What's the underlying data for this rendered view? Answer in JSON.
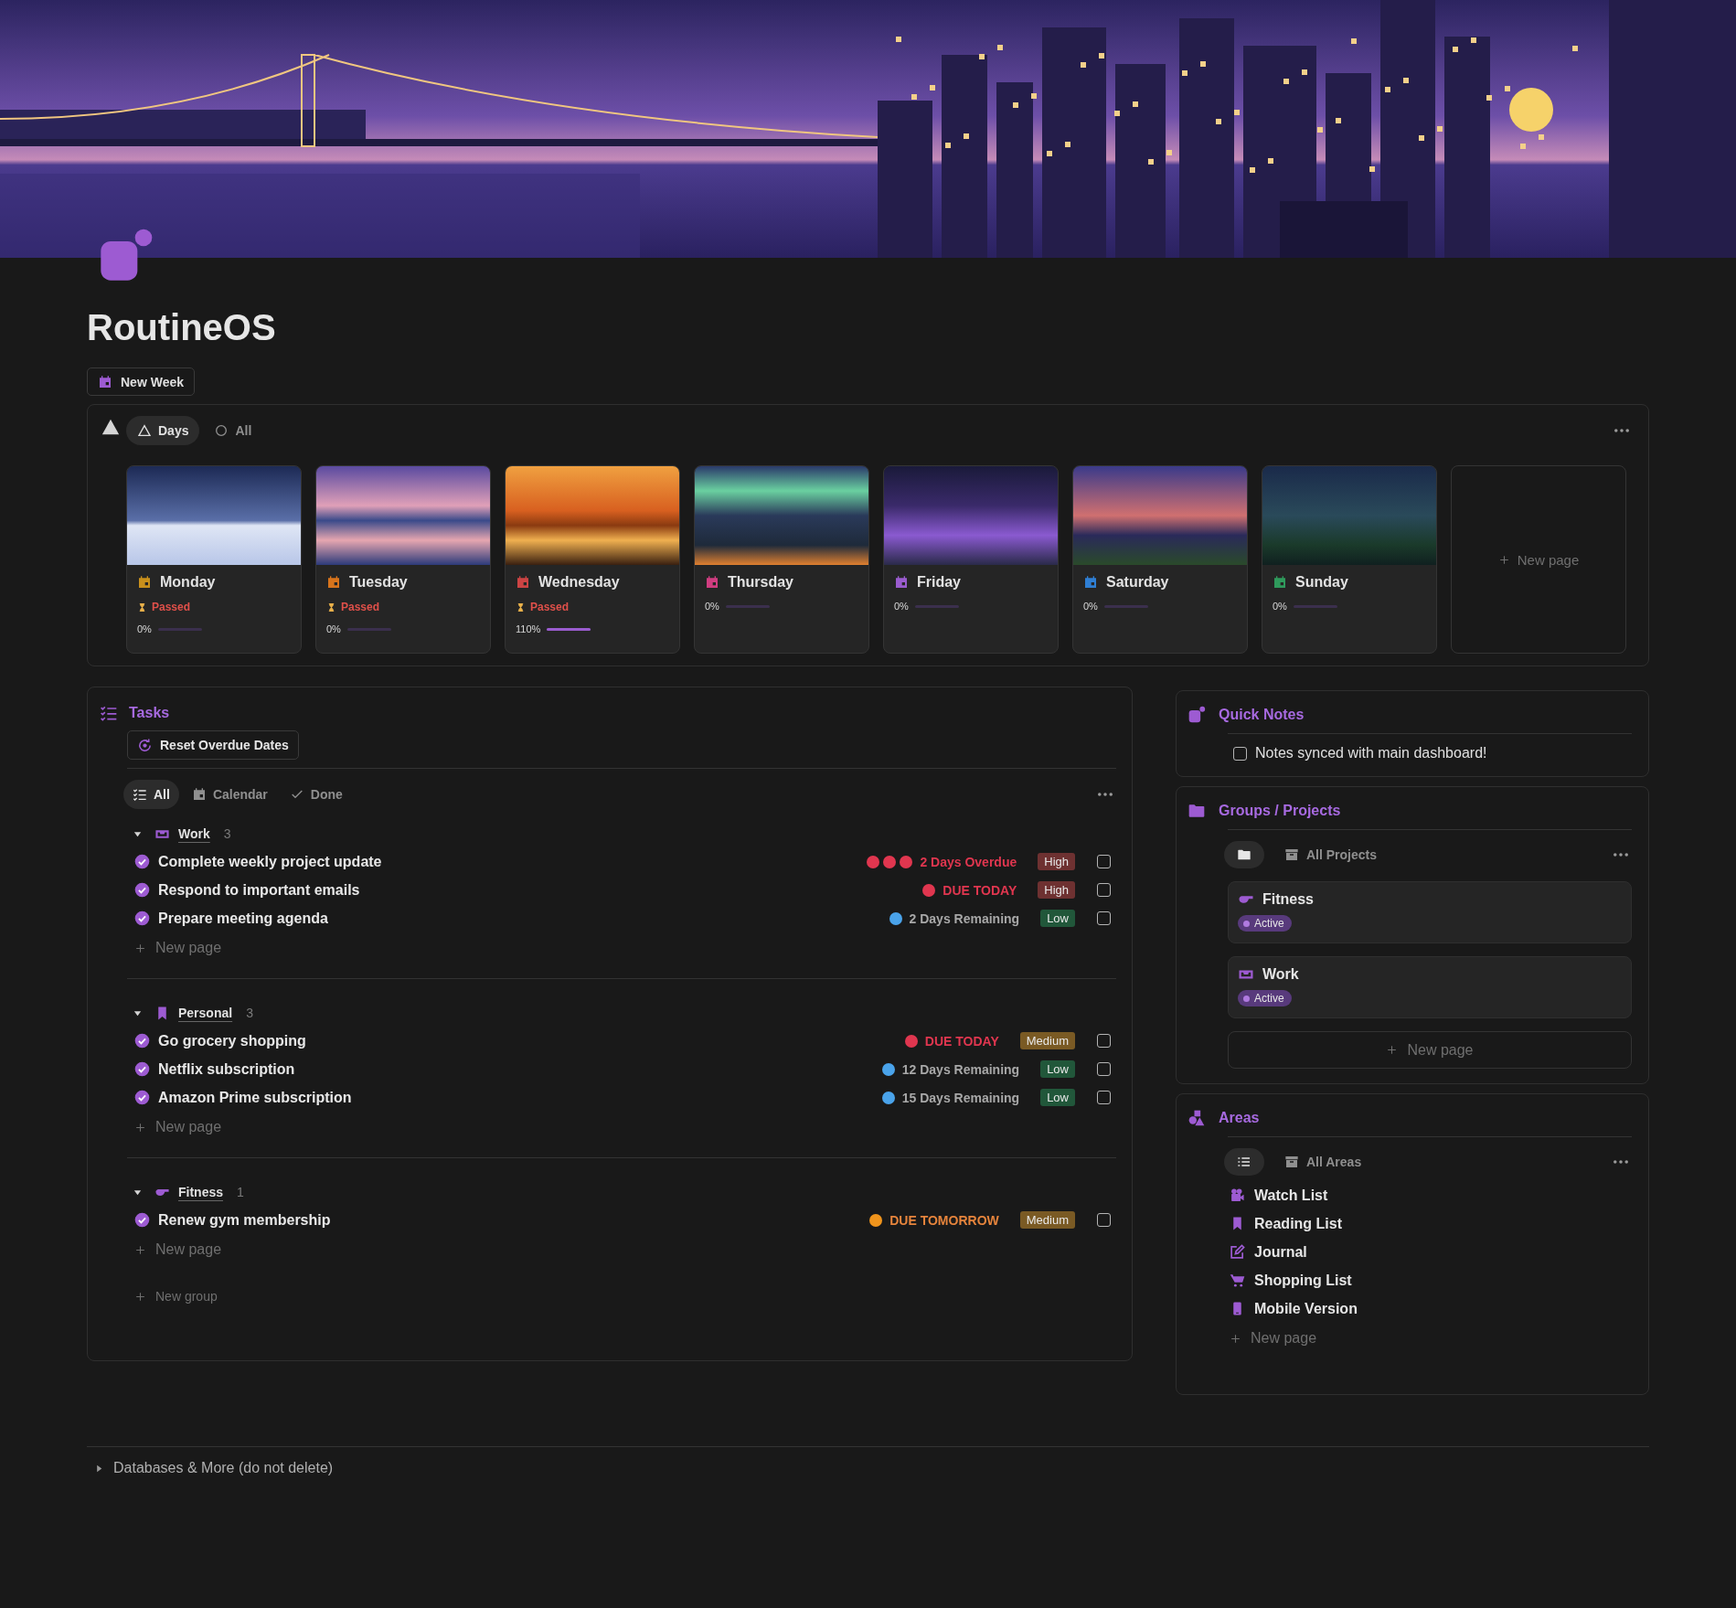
{
  "page": {
    "title": "RoutineOS"
  },
  "new_week_button": "New Week",
  "days": {
    "tabs": [
      {
        "label": "Days",
        "selected": true
      },
      {
        "label": "All",
        "selected": false
      }
    ],
    "cards": [
      {
        "name": "Monday",
        "color": "#c9901c",
        "status": "Passed",
        "progress": "0%",
        "level": 0
      },
      {
        "name": "Tuesday",
        "color": "#d8741c",
        "status": "Passed",
        "progress": "0%",
        "level": 0
      },
      {
        "name": "Wednesday",
        "color": "#cc4444",
        "status": "Passed",
        "progress": "110%",
        "level": 1
      },
      {
        "name": "Thursday",
        "color": "#d03d80",
        "progress": "0%",
        "level": 0
      },
      {
        "name": "Friday",
        "color": "#9a5ccf",
        "progress": "0%",
        "level": 0
      },
      {
        "name": "Saturday",
        "color": "#2f7fd4",
        "progress": "0%",
        "level": 0
      },
      {
        "name": "Sunday",
        "color": "#2f9a5c",
        "progress": "0%",
        "level": 0
      }
    ],
    "new_page": "New page"
  },
  "tasks": {
    "title": "Tasks",
    "reset_button": "Reset Overdue Dates",
    "views": [
      {
        "label": "All",
        "selected": true
      },
      {
        "label": "Calendar",
        "selected": false
      },
      {
        "label": "Done",
        "selected": false
      }
    ],
    "groups": [
      {
        "name": "Work",
        "count": "3",
        "expanded": true,
        "items": [
          {
            "title": "Complete weekly project update",
            "due": {
              "kind": "overdue",
              "text": "2 Days Overdue",
              "color": "#e0364f"
            },
            "priority": {
              "label": "High",
              "color": "#6e3131"
            },
            "checked": false
          },
          {
            "title": "Respond to important emails",
            "due": {
              "kind": "today",
              "text": "DUE TODAY",
              "color": "#e0364f"
            },
            "priority": {
              "label": "High",
              "color": "#6e3131"
            },
            "checked": false
          },
          {
            "title": "Prepare meeting agenda",
            "due": {
              "kind": "remaining",
              "text": "2 Days Remaining",
              "color": "#4aa3ea"
            },
            "priority": {
              "label": "Low",
              "color": "#21573a"
            },
            "checked": false
          }
        ],
        "new_page": "New page"
      },
      {
        "name": "Personal",
        "count": "3",
        "expanded": true,
        "items": [
          {
            "title": "Go grocery shopping",
            "due": {
              "kind": "today",
              "text": "DUE TODAY",
              "color": "#e0364f"
            },
            "priority": {
              "label": "Medium",
              "color": "#7a5a24"
            },
            "checked": false
          },
          {
            "title": "Netflix subscription",
            "due": {
              "kind": "remaining",
              "text": "12 Days Remaining",
              "color": "#4aa3ea"
            },
            "priority": {
              "label": "Low",
              "color": "#21573a"
            },
            "checked": false
          },
          {
            "title": "Amazon Prime subscription",
            "due": {
              "kind": "remaining",
              "text": "15 Days Remaining",
              "color": "#4aa3ea"
            },
            "priority": {
              "label": "Low",
              "color": "#21573a"
            },
            "checked": false
          }
        ],
        "new_page": "New page"
      },
      {
        "name": "Fitness",
        "count": "1",
        "expanded": true,
        "items": [
          {
            "title": "Renew gym membership",
            "due": {
              "kind": "tomorrow",
              "text": "DUE TOMORROW",
              "color": "#f0941c"
            },
            "priority": {
              "label": "Medium",
              "color": "#7a5a24"
            },
            "checked": false
          }
        ],
        "new_page": "New page"
      }
    ],
    "new_group": "New group"
  },
  "quick_notes": {
    "title": "Quick Notes",
    "items": [
      {
        "label": "Notes synced with main dashboard!",
        "checked": false
      }
    ]
  },
  "projects": {
    "title": "Groups / Projects",
    "views": [
      {
        "selected": true
      },
      {
        "label": "All Projects",
        "selected": false
      }
    ],
    "items": [
      {
        "name": "Fitness",
        "status": "Active"
      },
      {
        "name": "Work",
        "status": "Active"
      }
    ],
    "new_page": "New page"
  },
  "areas": {
    "title": "Areas",
    "views": [
      {
        "selected": true
      },
      {
        "label": "All Areas",
        "selected": false
      }
    ],
    "items": [
      "Watch List",
      "Reading List",
      "Journal",
      "Shopping List",
      "Mobile Version"
    ],
    "new_page": "New page"
  },
  "footer": {
    "label": "Databases & More (do not delete)",
    "expanded": false
  }
}
